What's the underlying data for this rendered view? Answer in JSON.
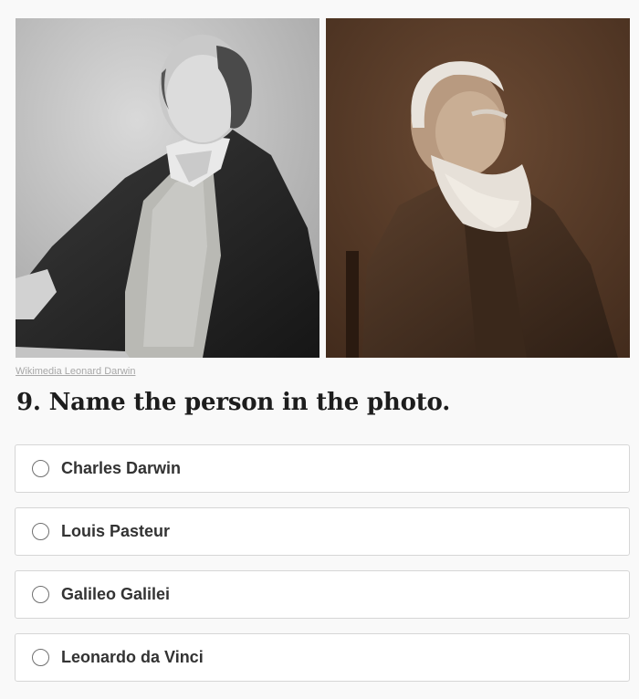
{
  "credit": "Wikimedia Leonard Darwin",
  "question": "9. Name the person in the photo.",
  "options": [
    {
      "label": "Charles Darwin"
    },
    {
      "label": "Louis Pasteur"
    },
    {
      "label": "Galileo Galilei"
    },
    {
      "label": "Leonardo da Vinci"
    }
  ]
}
